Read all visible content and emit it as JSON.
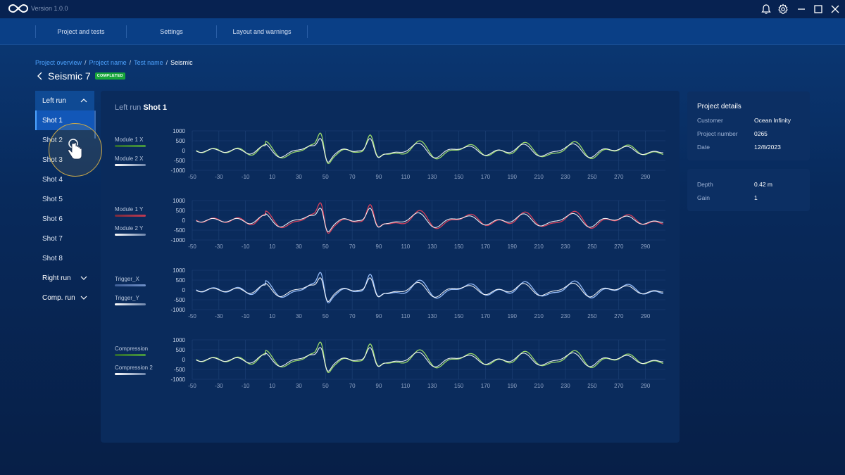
{
  "app": {
    "version": "Version 1.0.0"
  },
  "topnav": {
    "tabs": [
      "Project and tests",
      "Settings",
      "Layout and warnings"
    ]
  },
  "breadcrumb": {
    "items": [
      "Project overview",
      "Project name",
      "Test name"
    ],
    "current": "Seismic"
  },
  "page": {
    "title": "Seismic 7",
    "status": "COMPLETED"
  },
  "sidebar": {
    "left_run": "Left run",
    "shots": [
      "Shot 1",
      "Shot 2",
      "Shot 3",
      "Shot 4",
      "Shot 5",
      "Shot 6",
      "Shot 7",
      "Shot 8"
    ],
    "active_shot": "Shot 1",
    "right_run": "Right run",
    "comp_run": "Comp. run"
  },
  "panel": {
    "subtitle": "Left run",
    "title": "Shot 1"
  },
  "colors": {
    "green": "#9fe06a",
    "dark_green": "#3f8f3f",
    "red": "#e0405a",
    "light_blue": "#9bc2ff",
    "blue": "#4f74b8",
    "white": "#ffffff",
    "accent": "#4ea3ff",
    "badge": "#17a63a"
  },
  "chart_data": [
    {
      "type": "line",
      "series": [
        {
          "name": "Module 1 X",
          "color": "#9fe06a"
        },
        {
          "name": "Module 2 X",
          "color": "#ffffff"
        }
      ],
      "yticks": [
        "1000",
        "500",
        "0",
        "-500",
        "-1000"
      ],
      "xticks": [
        "-50",
        "-30",
        "-10",
        "10",
        "30",
        "50",
        "70",
        "90",
        "110",
        "130",
        "150",
        "170",
        "190",
        "210",
        "230",
        "250",
        "270",
        "290"
      ],
      "xlim": [
        -50,
        305
      ],
      "ylim": [
        -1000,
        1000
      ]
    },
    {
      "type": "line",
      "series": [
        {
          "name": "Module 1 Y",
          "color": "#e0405a"
        },
        {
          "name": "Module 2 Y",
          "color": "#ffffff"
        }
      ],
      "yticks": [
        "1000",
        "500",
        "0",
        "-500",
        "-1000"
      ],
      "xticks": [
        "-50",
        "-30",
        "-10",
        "10",
        "30",
        "50",
        "70",
        "90",
        "110",
        "130",
        "150",
        "170",
        "190",
        "210",
        "230",
        "250",
        "270",
        "290"
      ],
      "xlim": [
        -50,
        305
      ],
      "ylim": [
        -1000,
        1000
      ]
    },
    {
      "type": "line",
      "series": [
        {
          "name": "Trigger_X",
          "color": "#9bc2ff"
        },
        {
          "name": "Trigger_Y",
          "color": "#ffffff"
        }
      ],
      "yticks": [
        "1000",
        "500",
        "0",
        "-500",
        "-1000"
      ],
      "xticks": [
        "-50",
        "-30",
        "-10",
        "10",
        "30",
        "50",
        "70",
        "90",
        "110",
        "130",
        "150",
        "170",
        "190",
        "210",
        "230",
        "250",
        "270",
        "290"
      ],
      "xlim": [
        -50,
        305
      ],
      "ylim": [
        -1000,
        1000
      ]
    },
    {
      "type": "line",
      "series": [
        {
          "name": "Compression",
          "color": "#9fe06a"
        },
        {
          "name": "Compression 2",
          "color": "#ffffff"
        }
      ],
      "yticks": [
        "1000",
        "500",
        "0",
        "-500",
        "-1000"
      ],
      "xticks": [
        "-50",
        "-30",
        "-10",
        "10",
        "30",
        "50",
        "70",
        "90",
        "110",
        "130",
        "150",
        "170",
        "190",
        "210",
        "230",
        "250",
        "270",
        "290"
      ],
      "xlim": [
        -50,
        305
      ],
      "ylim": [
        -1000,
        1000
      ]
    }
  ],
  "project_details": {
    "title": "Project details",
    "rows": [
      {
        "key": "Customer",
        "value": "Ocean Infinity"
      },
      {
        "key": "Project number",
        "value": "0265"
      },
      {
        "key": "Date",
        "value": "12/8/2023"
      }
    ]
  },
  "measurements": {
    "rows": [
      {
        "key": "Depth",
        "value": "0.42 m"
      },
      {
        "key": "Gain",
        "value": "1"
      }
    ]
  }
}
